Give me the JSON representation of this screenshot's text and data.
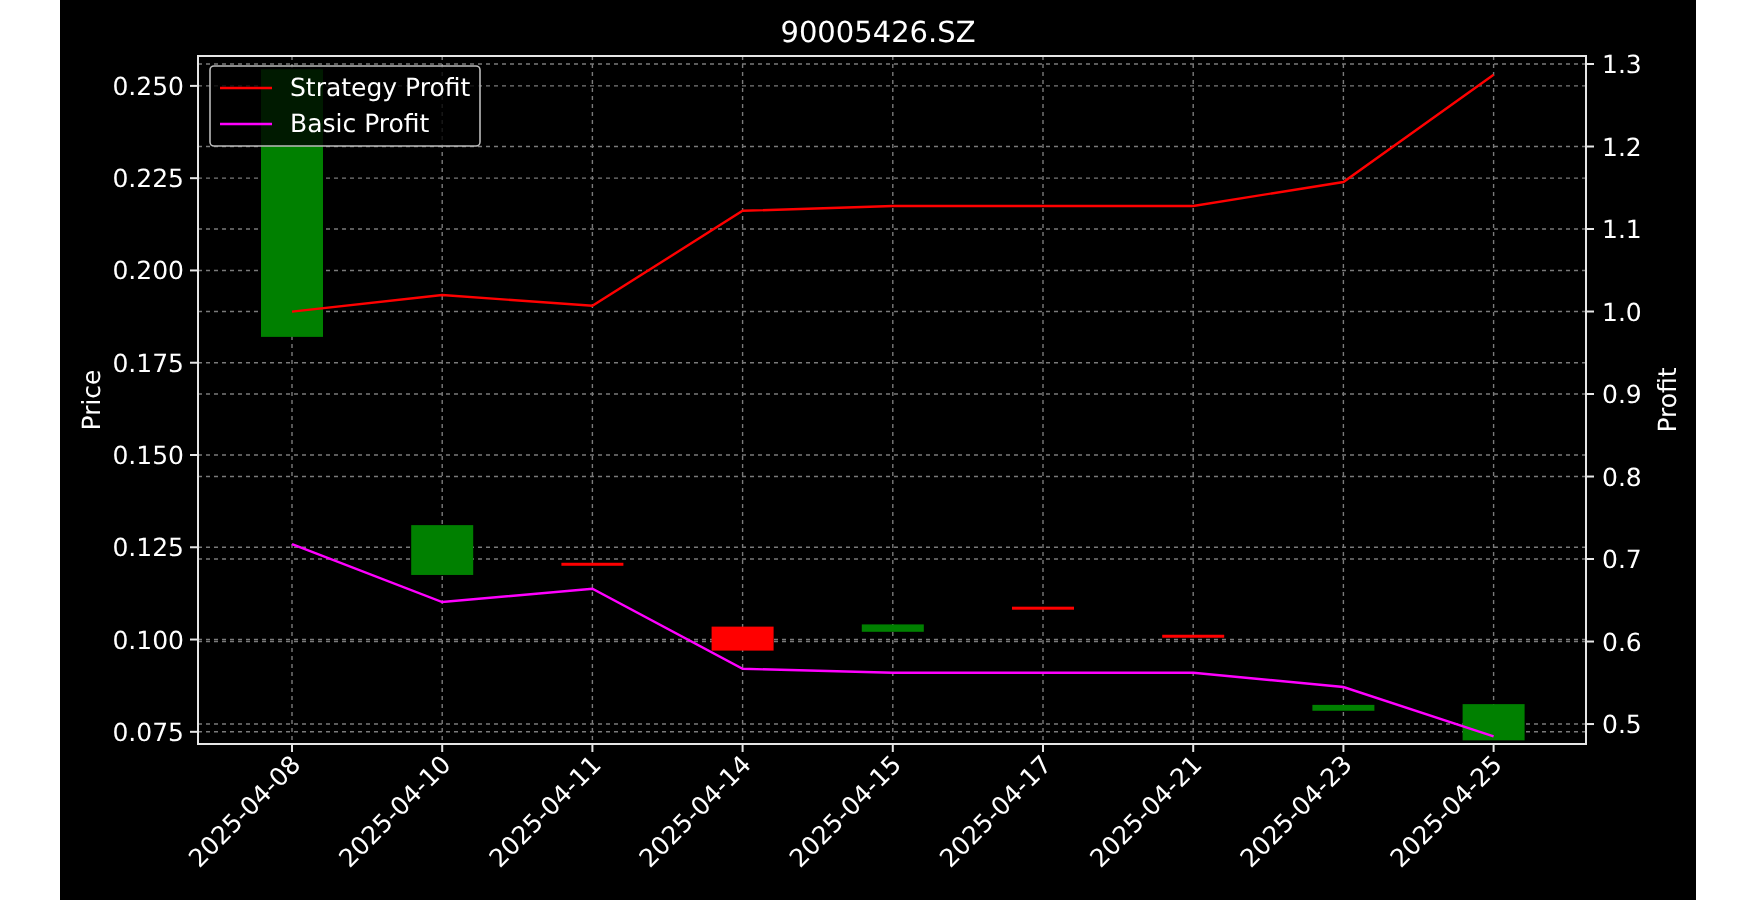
{
  "figure": {
    "chart_data": {
      "type": "line",
      "title": "90005426.SZ",
      "ylabel": "Price",
      "y2label": "Profit",
      "grid": true,
      "legend": true,
      "categories": [
        "2025-04-08",
        "2025-04-10",
        "2025-04-11",
        "2025-04-14",
        "2025-04-15",
        "2025-04-17",
        "2025-04-21",
        "2025-04-23",
        "2025-04-25"
      ],
      "ylim": [
        0.0717,
        0.2581
      ],
      "yticks": [
        {
          "value": 0.075,
          "label": "0.075"
        },
        {
          "value": 0.1,
          "label": "0.100"
        },
        {
          "value": 0.125,
          "label": "0.125"
        },
        {
          "value": 0.15,
          "label": "0.150"
        },
        {
          "value": 0.175,
          "label": "0.175"
        },
        {
          "value": 0.2,
          "label": "0.200"
        },
        {
          "value": 0.225,
          "label": "0.225"
        },
        {
          "value": 0.25,
          "label": "0.250"
        }
      ],
      "y2lim": [
        0.4758,
        1.3097
      ],
      "y2ticks": [
        {
          "value": 0.5,
          "label": "0.5"
        },
        {
          "value": 0.6,
          "label": "0.6"
        },
        {
          "value": 0.7,
          "label": "0.7"
        },
        {
          "value": 0.8,
          "label": "0.8"
        },
        {
          "value": 0.9,
          "label": "0.9"
        },
        {
          "value": 1.0,
          "label": "1.0"
        },
        {
          "value": 1.1,
          "label": "1.1"
        },
        {
          "value": 1.2,
          "label": "1.2"
        },
        {
          "value": 1.3,
          "label": "1.3"
        }
      ],
      "series": [
        {
          "name": "Strategy Profit",
          "color": "#ff0000",
          "axis": "y2",
          "values": [
            1.0,
            1.02,
            1.007,
            1.122,
            1.128,
            1.128,
            1.128,
            1.157,
            1.287
          ]
        },
        {
          "name": "Basic Profit",
          "color": "#ff00ff",
          "axis": "y2",
          "values": [
            0.718,
            0.648,
            0.664,
            0.567,
            0.562,
            0.562,
            0.562,
            0.545,
            0.485
          ]
        }
      ]
    },
    "candles": [
      {
        "color": "#008000"
      },
      {
        "color": "#008000"
      },
      {
        "color": "#ff0000"
      },
      {
        "color": "#ff0000"
      },
      {
        "color": "#008000"
      },
      {
        "color": "#ff0000"
      },
      {
        "color": "#ff0000"
      },
      {
        "color": "#008000"
      },
      {
        "color": "#008000"
      }
    ]
  }
}
